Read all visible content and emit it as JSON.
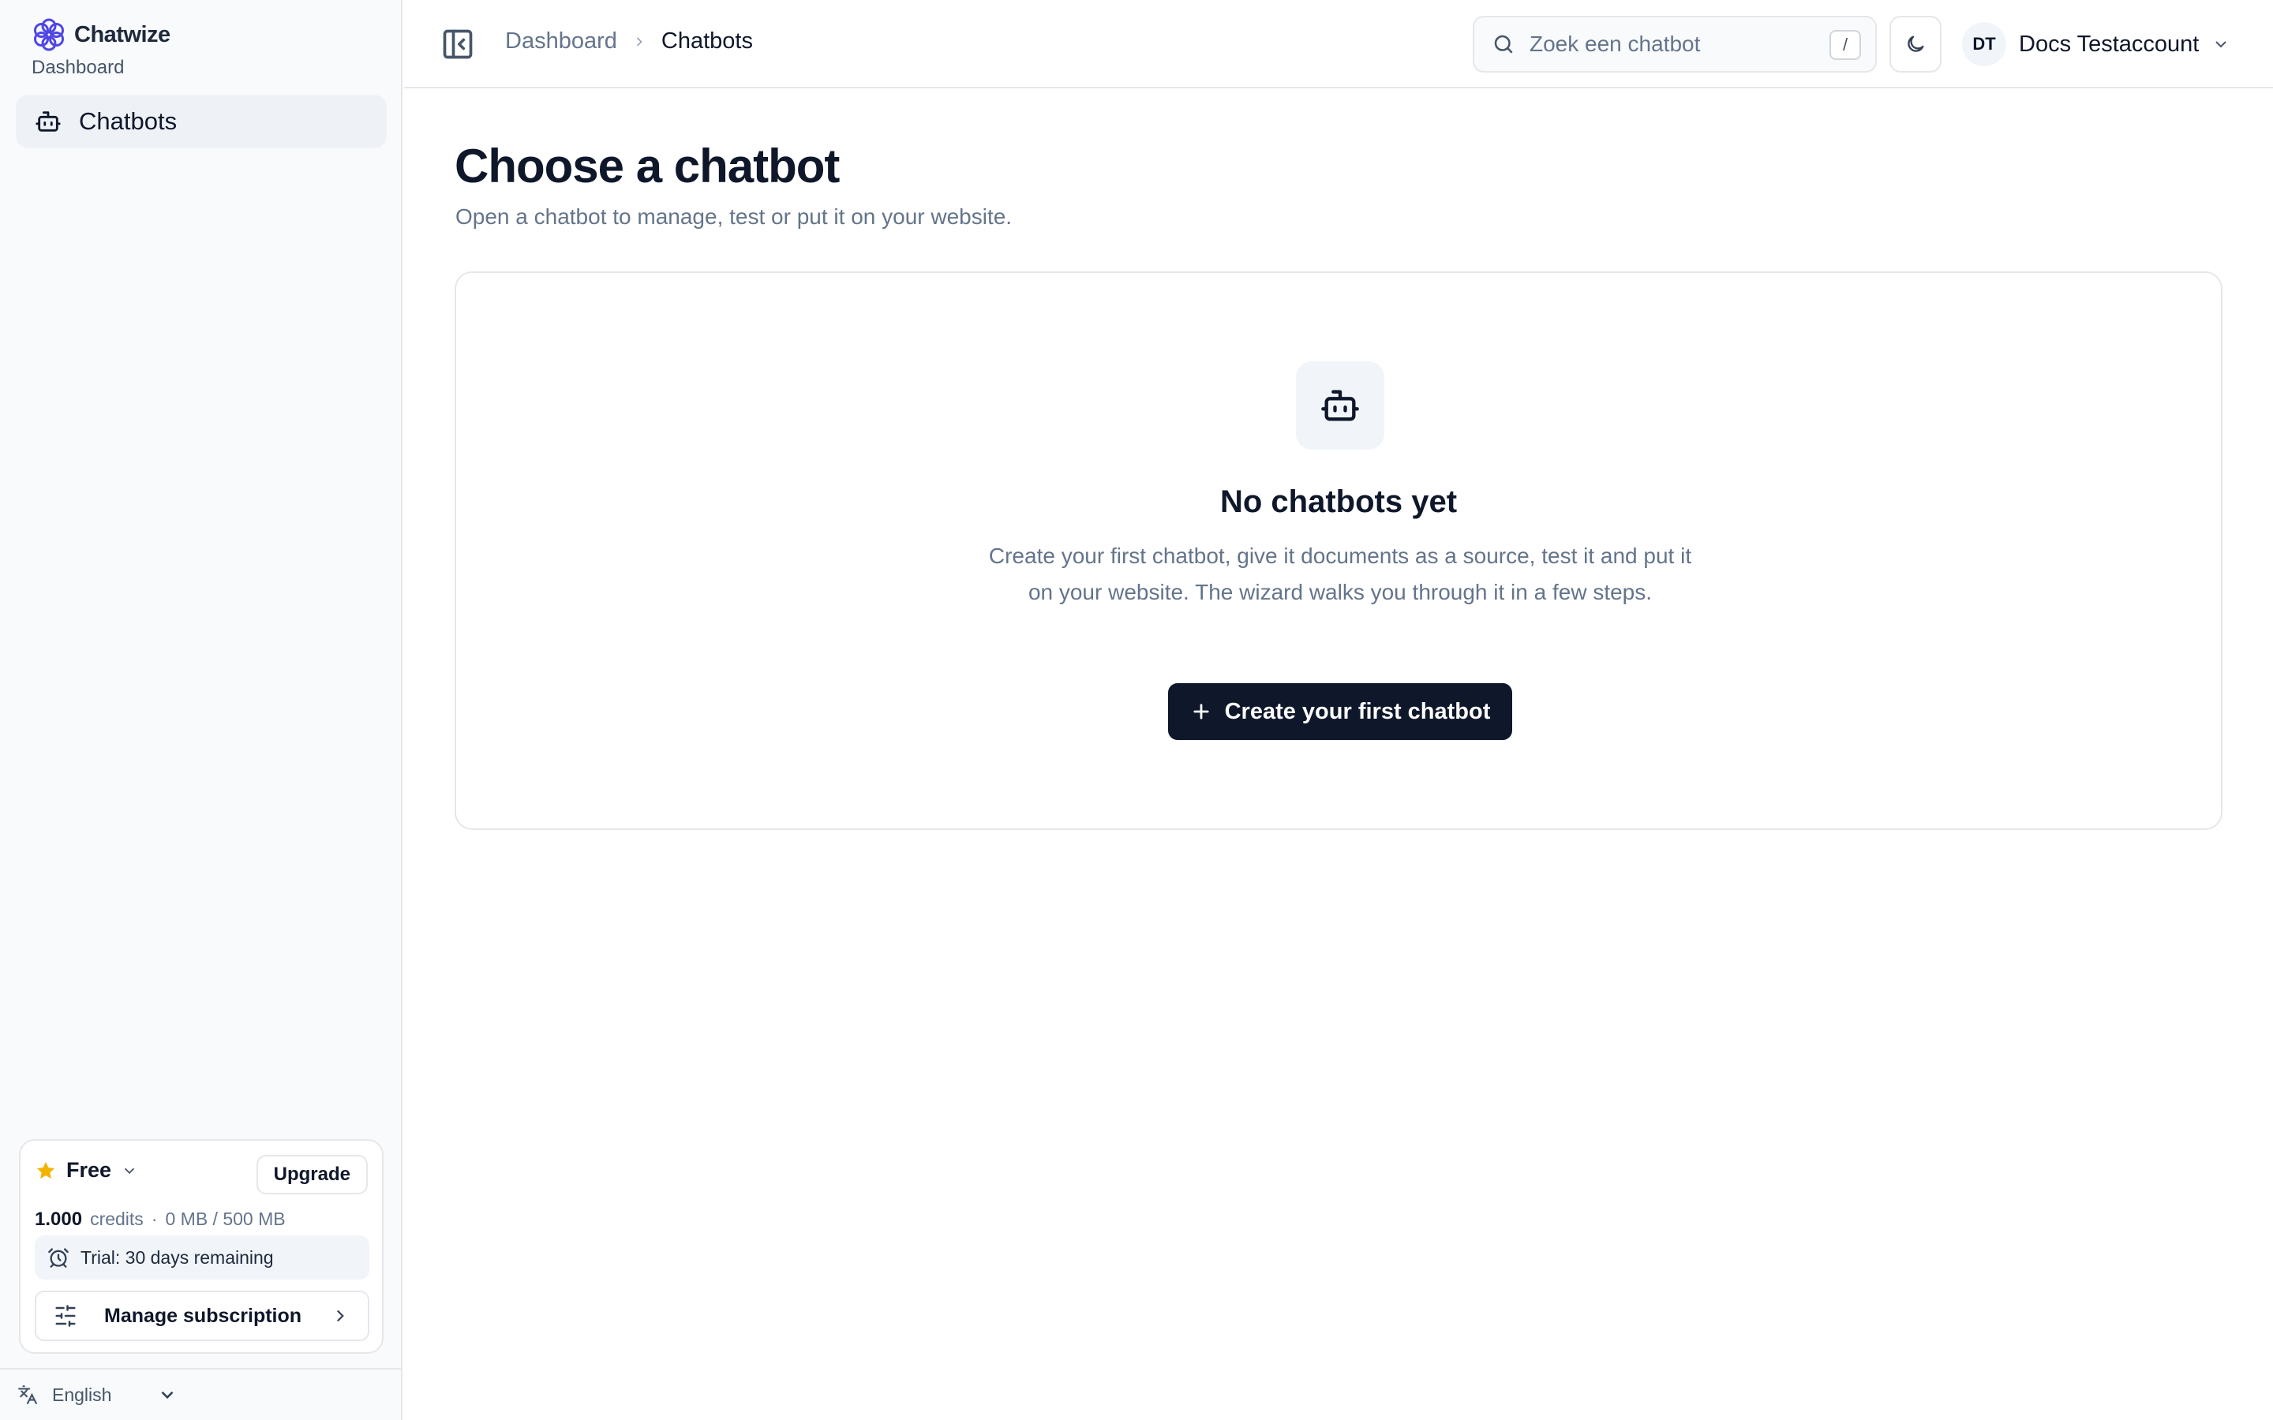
{
  "app": {
    "name": "Chatwize",
    "subtitle": "Dashboard"
  },
  "sidebar": {
    "items": [
      {
        "label": "Chatbots",
        "icon": "bot-icon",
        "active": true
      }
    ],
    "plan": {
      "name": "Free",
      "upgrade_label": "Upgrade",
      "credits_value": "1.000",
      "credits_label": "credits",
      "separator": "·",
      "storage": "0 MB / 500 MB",
      "trial": "Trial: 30 days remaining",
      "manage_label": "Manage subscription"
    },
    "language": "English"
  },
  "header": {
    "breadcrumb": [
      "Dashboard",
      "Chatbots"
    ],
    "search_placeholder": "Zoek een chatbot",
    "search_shortcut": "/",
    "account": {
      "initials": "DT",
      "name": "Docs Testaccount"
    }
  },
  "main": {
    "title": "Choose a chatbot",
    "subtitle": "Open a chatbot to manage, test or put it on your website.",
    "empty": {
      "title": "No chatbots yet",
      "description": "Create your first chatbot, give it documents as a source, test it and put it on your website. The wizard walks you through it in a few steps.",
      "cta_label": "Create your first chatbot"
    }
  },
  "colors": {
    "primary": "#0f172a",
    "brand": "#4f46e5",
    "star": "#f5b301",
    "muted": "#64748b",
    "border": "#e5e7eb"
  }
}
